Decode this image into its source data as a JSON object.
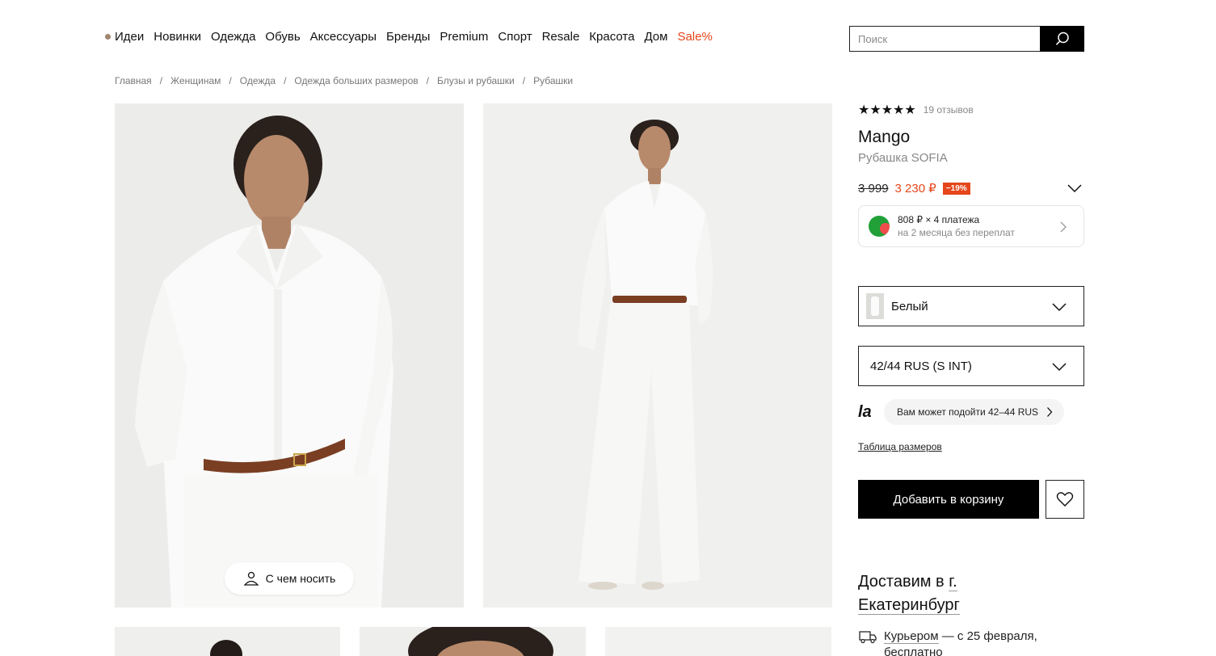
{
  "nav": {
    "items": [
      "Идеи",
      "Новинки",
      "Одежда",
      "Обувь",
      "Аксессуары",
      "Бренды",
      "Premium",
      "Спорт",
      "Resale",
      "Красота",
      "Дом"
    ],
    "sale": "Sale%",
    "sale_color": "#e5461b"
  },
  "search": {
    "placeholder": "Поиск"
  },
  "breadcrumb": [
    "Главная",
    "Женщинам",
    "Одежда",
    "Одежда больших размеров",
    "Блузы и рубашки",
    "Рубашки"
  ],
  "gallery": {
    "wear_button": "С чем носить"
  },
  "product": {
    "stars": "★★★★★",
    "rating": 5,
    "reviews": "19 отзывов",
    "brand": "Mango",
    "name": "Рубашка SOFIA",
    "old_price": "3 999",
    "new_price": "3 230 ₽",
    "discount": "−19%",
    "split_line1": "808 ₽ × 4 платежа",
    "split_line2": "на 2 месяца без переплат",
    "color": "Белый",
    "size": "42/44 RUS (S INT)",
    "fit_logo": "la",
    "fit_hint": "Вам может подойти 42–44 RUS",
    "size_table": "Таблица размеров",
    "add_to_cart": "Добавить в корзину",
    "delivery_prefix": "Доставим в",
    "delivery_city": "г. Екатеринбург",
    "courier_link": "Курьером",
    "courier_rest": " — с 25 февраля,",
    "courier_line2": "бесплатно"
  },
  "colors": {
    "accent": "#e5461b",
    "primary": "#000000"
  }
}
